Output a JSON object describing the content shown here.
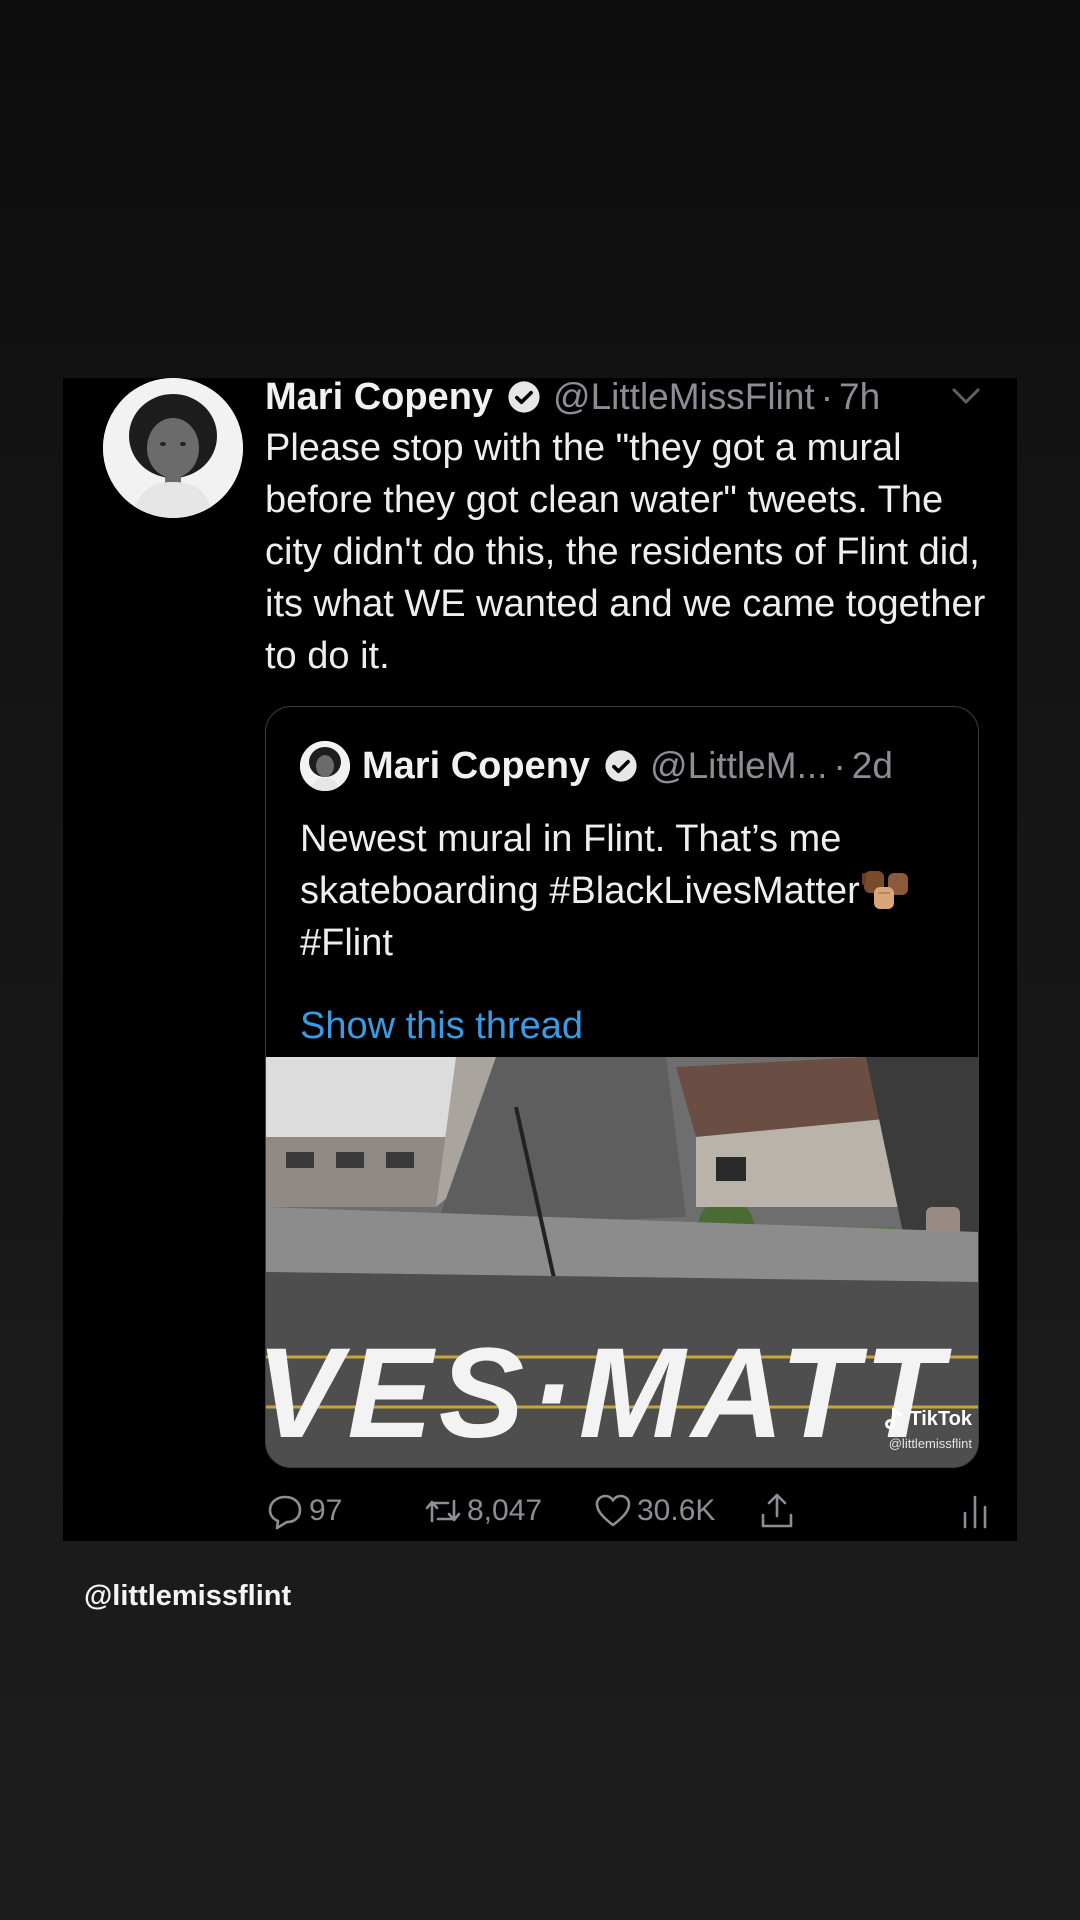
{
  "tweet": {
    "author_name": "Mari Copeny",
    "handle": "@LittleMissFlint",
    "separator": "·",
    "time": "7h",
    "text": "Please stop with the \"they got a mural before they got clean water\" tweets. The city didn't do this, the residents of Flint did, its what WE wanted and we came together to do it.",
    "icons": {
      "verified": "verified-badge-icon",
      "menu": "chevron-down-icon"
    }
  },
  "quoted_tweet": {
    "author_name": "Mari Copeny",
    "handle": "@LittleM...",
    "separator": "·",
    "time": "2d",
    "text_main": "Newest mural in Flint. That’s me skateboarding #BlackLivesMatter",
    "emoji": "raised-fists-emoji",
    "text_tag": "#Flint",
    "show_thread": "Show this thread",
    "media": {
      "painted_text": "VES·MATT",
      "watermark_brand": "TikTok",
      "watermark_user": "@littlemissflint"
    }
  },
  "actions": {
    "replies": "97",
    "retweets": "8,047",
    "likes": "30.6K",
    "icons": [
      "reply-icon",
      "retweet-icon",
      "like-icon",
      "share-icon",
      "analytics-icon"
    ]
  },
  "caption": "@littlemissflint",
  "colors": {
    "background": "#121212",
    "card": "#000000",
    "text": "#eeeeee",
    "muted": "#8b8f95",
    "link": "#3a9be3"
  }
}
